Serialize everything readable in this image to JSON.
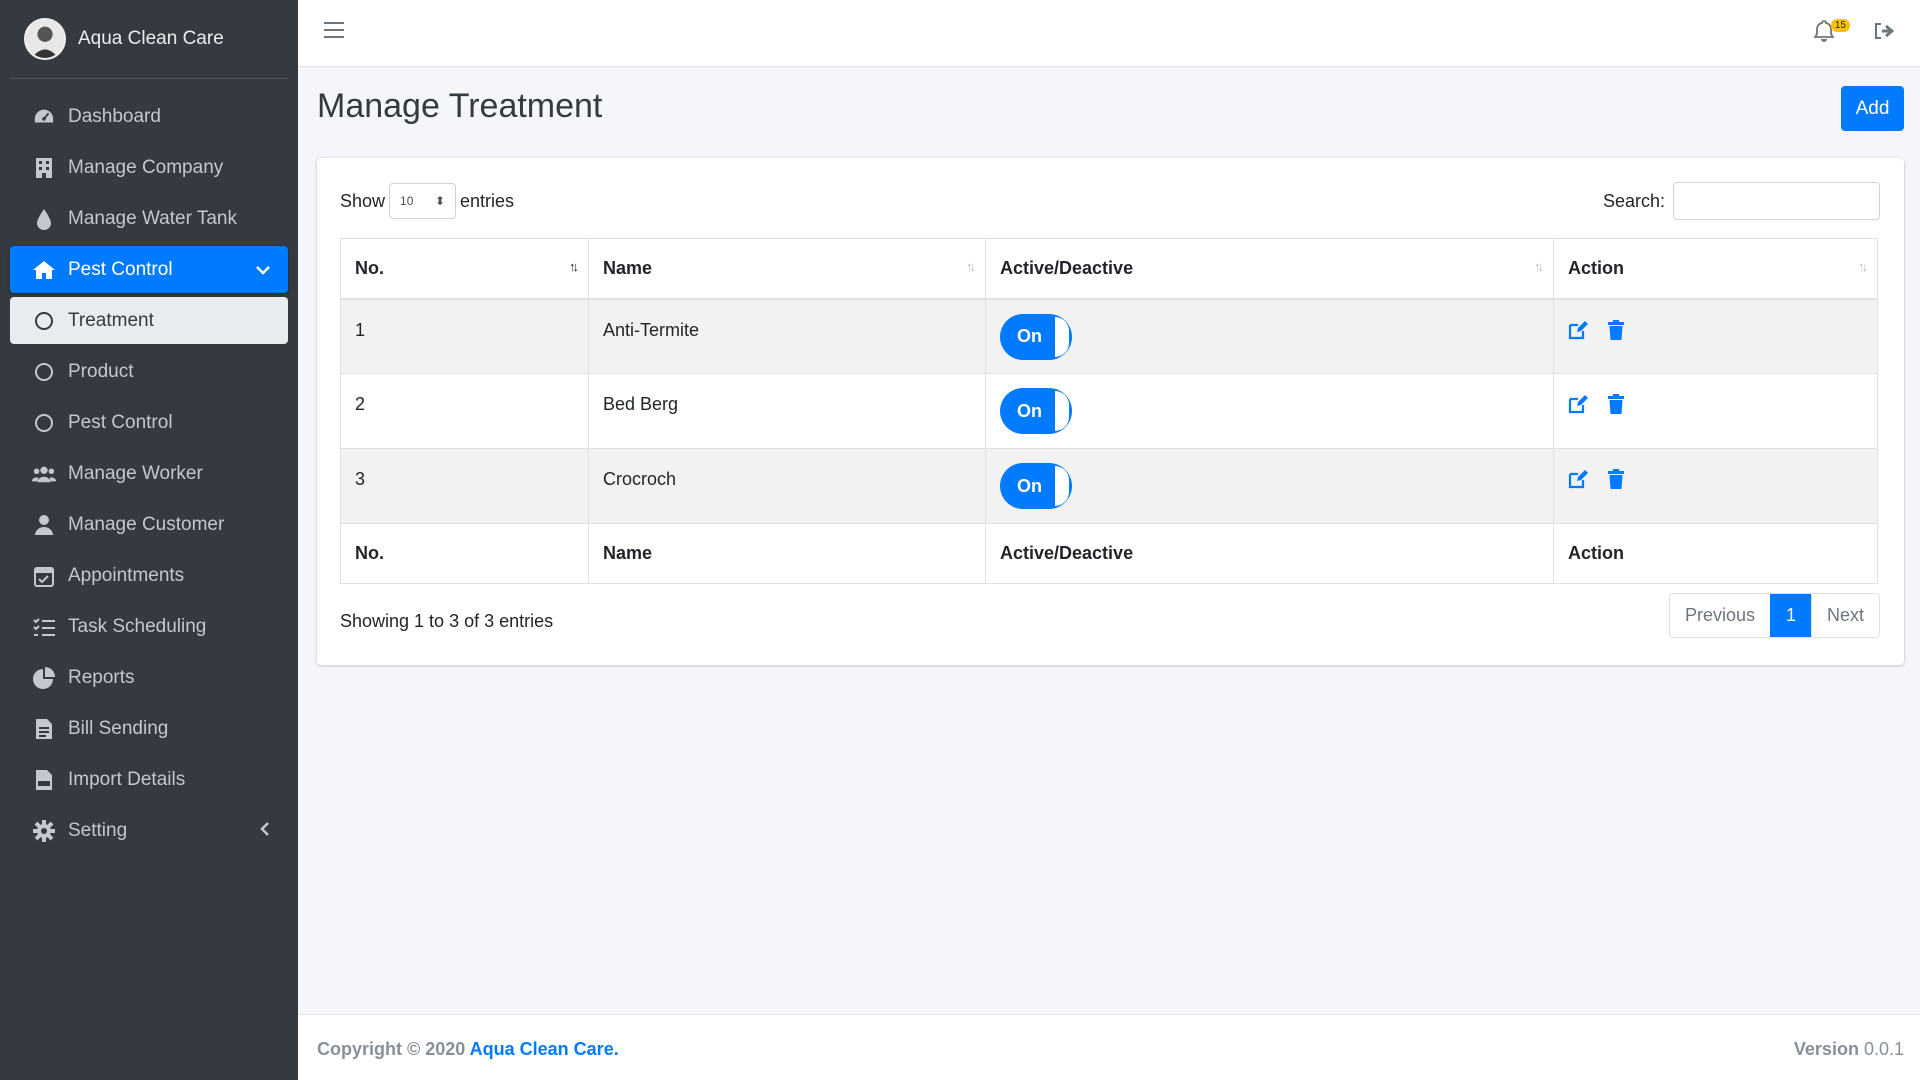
{
  "brand": {
    "name": "Aqua Clean Care"
  },
  "sidebar": {
    "items": [
      {
        "label": "Dashboard",
        "icon": "dashboard-icon"
      },
      {
        "label": "Manage Company",
        "icon": "building-icon"
      },
      {
        "label": "Manage Water Tank",
        "icon": "water-drop-icon"
      },
      {
        "label": "Pest Control",
        "icon": "home-icon"
      },
      {
        "label": "Treatment",
        "icon": "circle-icon"
      },
      {
        "label": "Product",
        "icon": "circle-icon"
      },
      {
        "label": "Pest Control",
        "icon": "circle-icon"
      },
      {
        "label": "Manage Worker",
        "icon": "users-icon"
      },
      {
        "label": "Manage Customer",
        "icon": "user-icon"
      },
      {
        "label": "Appointments",
        "icon": "calendar-check-icon"
      },
      {
        "label": "Task Scheduling",
        "icon": "tasks-icon"
      },
      {
        "label": "Reports",
        "icon": "pie-chart-icon"
      },
      {
        "label": "Bill Sending",
        "icon": "file-invoice-icon"
      },
      {
        "label": "Import Details",
        "icon": "csv-file-icon"
      },
      {
        "label": "Setting",
        "icon": "gear-icon"
      }
    ]
  },
  "header": {
    "notification_count": "15"
  },
  "page": {
    "title": "Manage Treatment",
    "add_label": "Add"
  },
  "table_controls": {
    "show_label": "Show",
    "entries_value": "10",
    "entries_label": "entries",
    "search_label": "Search:",
    "search_value": ""
  },
  "table": {
    "columns": [
      "No.",
      "Name",
      "Active/Deactive",
      "Action"
    ],
    "rows": [
      {
        "no": "1",
        "name": "Anti-Termite",
        "status": "On"
      },
      {
        "no": "2",
        "name": "Bed Berg",
        "status": "On"
      },
      {
        "no": "3",
        "name": "Crocroch",
        "status": "On"
      }
    ]
  },
  "pagination": {
    "info": "Showing 1 to 3 of 3 entries",
    "previous": "Previous",
    "current": "1",
    "next": "Next"
  },
  "footer": {
    "copyright_prefix": "Copyright © 2020",
    "company": "Aqua Clean Care.",
    "version_label": "Version",
    "version_value": "0.0.1"
  },
  "colors": {
    "primary": "#007bff",
    "sidebar_bg": "#343a40",
    "badge": "#ffc107"
  }
}
